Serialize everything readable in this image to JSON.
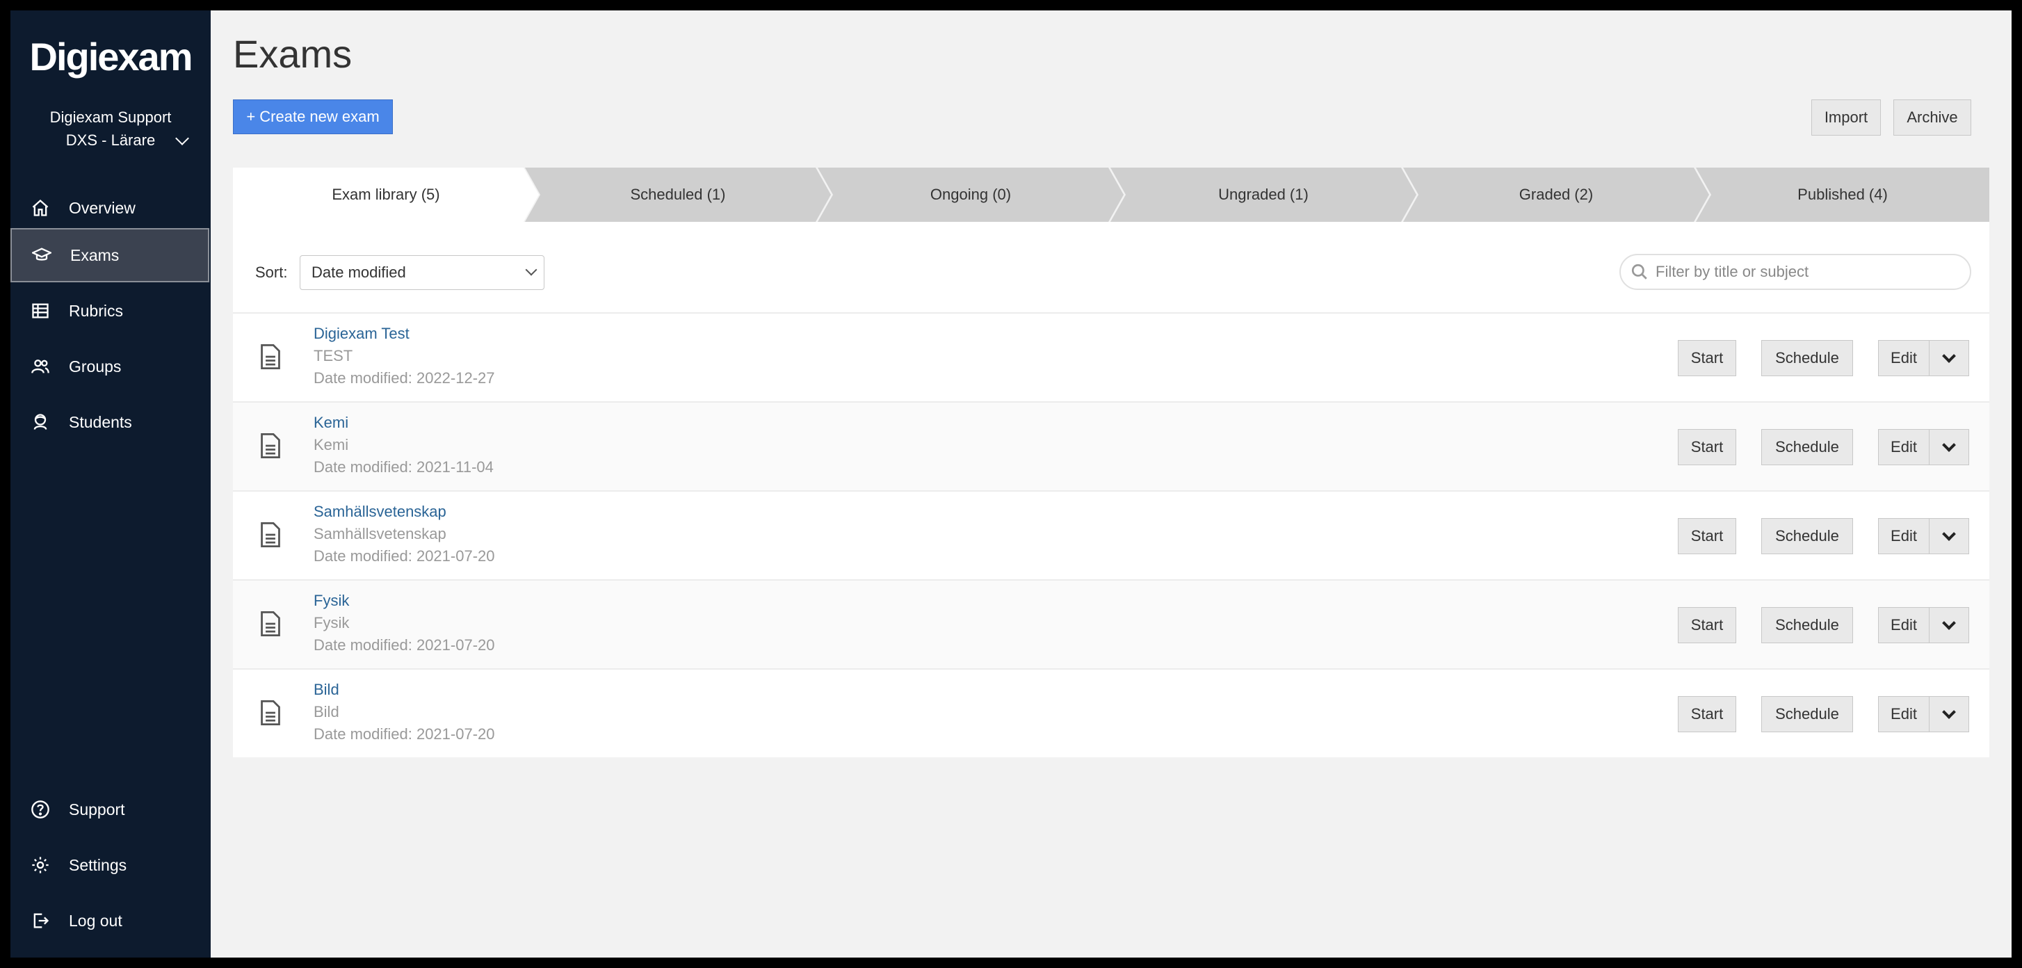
{
  "sidebar": {
    "logo": "Digiexam",
    "account_name": "Digiexam Support",
    "account_role": "DXS - Lärare",
    "nav": [
      {
        "label": "Overview",
        "icon": "home-icon"
      },
      {
        "label": "Exams",
        "icon": "graduation-cap-icon"
      },
      {
        "label": "Rubrics",
        "icon": "table-icon"
      },
      {
        "label": "Groups",
        "icon": "users-icon"
      },
      {
        "label": "Students",
        "icon": "student-icon"
      }
    ],
    "bottom_nav": [
      {
        "label": "Support",
        "icon": "question-icon"
      },
      {
        "label": "Settings",
        "icon": "gear-icon"
      },
      {
        "label": "Log out",
        "icon": "logout-icon"
      }
    ]
  },
  "header": {
    "title": "Exams",
    "create_label": "+ Create new exam",
    "import_label": "Import",
    "archive_label": "Archive"
  },
  "tabs": [
    {
      "label": "Exam library (5)"
    },
    {
      "label": "Scheduled (1)"
    },
    {
      "label": "Ongoing (0)"
    },
    {
      "label": "Ungraded (1)"
    },
    {
      "label": "Graded (2)"
    },
    {
      "label": "Published (4)"
    }
  ],
  "toolbar": {
    "sort_label": "Sort:",
    "sort_value": "Date modified",
    "filter_placeholder": "Filter by title or subject"
  },
  "exams": [
    {
      "title": "Digiexam Test",
      "subject": "TEST",
      "date": "Date modified: 2022-12-27"
    },
    {
      "title": "Kemi",
      "subject": "Kemi",
      "date": "Date modified: 2021-11-04"
    },
    {
      "title": "Samhällsvetenskap",
      "subject": "Samhällsvetenskap",
      "date": "Date modified: 2021-07-20"
    },
    {
      "title": "Fysik",
      "subject": "Fysik",
      "date": "Date modified: 2021-07-20"
    },
    {
      "title": "Bild",
      "subject": "Bild",
      "date": "Date modified: 2021-07-20"
    }
  ],
  "row_actions": {
    "start": "Start",
    "schedule": "Schedule",
    "edit": "Edit"
  },
  "colors": {
    "sidebar_bg": "#0d1b2e",
    "primary_button": "#4a86e8",
    "link": "#2a6496"
  }
}
